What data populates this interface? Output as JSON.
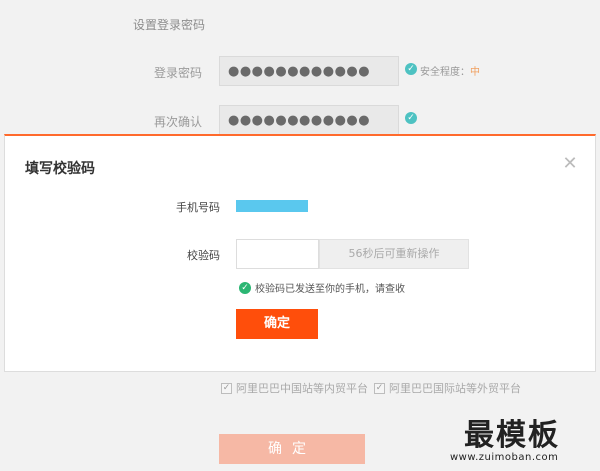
{
  "background": {
    "section_title": "设置登录密码",
    "password_label": "登录密码",
    "password_dots": "●●●●●●●●●●●●",
    "strength_label": "安全程度：",
    "strength_value": "中",
    "confirm_label": "再次确认",
    "confirm_dots": "●●●●●●●●●●●●",
    "options": [
      {
        "label": "阿里巴巴中国站等内贸平台",
        "checked": true
      },
      {
        "label": "阿里巴巴国际站等外贸平台",
        "checked": true
      }
    ],
    "confirm_button": "确定"
  },
  "modal": {
    "title": "填写校验码",
    "close_glyph": "✕",
    "phone_label": "手机号码",
    "code_label": "校验码",
    "code_value": "",
    "resend_label": "56秒后可重新操作",
    "sent_tip": "校验码已发送至你的手机，请查收",
    "ok_label": "确定"
  },
  "watermark": {
    "main": "最模板",
    "sub": "www.zuimoban.com"
  },
  "colors": {
    "accent": "#ff4e0b",
    "modal_border": "#ff6a2c",
    "phone_mask": "#5ac8ee",
    "success": "#2bb673",
    "teal_check": "#4ec2c2"
  }
}
